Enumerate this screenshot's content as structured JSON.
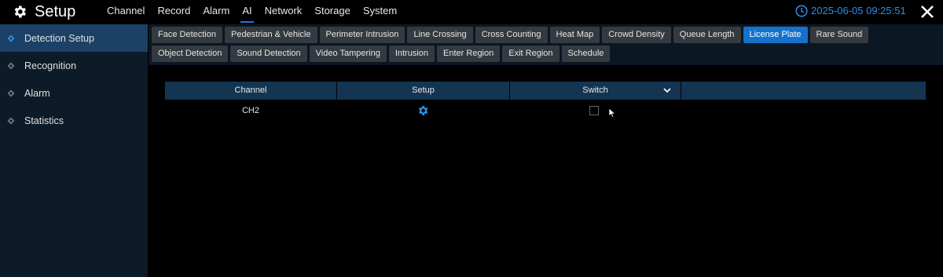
{
  "header": {
    "title": "Setup",
    "nav": [
      {
        "label": "Channel",
        "active": false
      },
      {
        "label": "Record",
        "active": false
      },
      {
        "label": "Alarm",
        "active": false
      },
      {
        "label": "AI",
        "active": true
      },
      {
        "label": "Network",
        "active": false
      },
      {
        "label": "Storage",
        "active": false
      },
      {
        "label": "System",
        "active": false
      }
    ],
    "datetime": "2025-06-05 09:25:51",
    "icons": {
      "logo": "gear-icon",
      "clock": "clock-icon",
      "close": "close-icon"
    }
  },
  "sidebar": {
    "items": [
      {
        "label": "Detection Setup",
        "active": true
      },
      {
        "label": "Recognition",
        "active": false
      },
      {
        "label": "Alarm",
        "active": false
      },
      {
        "label": "Statistics",
        "active": false
      }
    ]
  },
  "subtabs": {
    "row1": [
      "Face Detection",
      "Pedestrian & Vehicle",
      "Perimeter Intrusion",
      "Line Crossing",
      "Cross Counting",
      "Heat Map",
      "Crowd Density",
      "Queue Length",
      "License Plate",
      "Rare Sound"
    ],
    "row2": [
      "Object Detection",
      "Sound Detection",
      "Video Tampering",
      "Intrusion",
      "Enter Region",
      "Exit Region",
      "Schedule"
    ],
    "active": "License Plate"
  },
  "table": {
    "columns": [
      "Channel",
      "Setup",
      "Switch",
      ""
    ],
    "rows": [
      {
        "channel": "CH2",
        "setup_icon": "gear-icon",
        "switch_checked": false
      }
    ]
  },
  "colors": {
    "accent": "#1572cc",
    "clock_text": "#2b8ee8",
    "header_row": "#143552",
    "sidebar_bg": "#0d1a27",
    "sidebar_active": "#1b4266"
  }
}
